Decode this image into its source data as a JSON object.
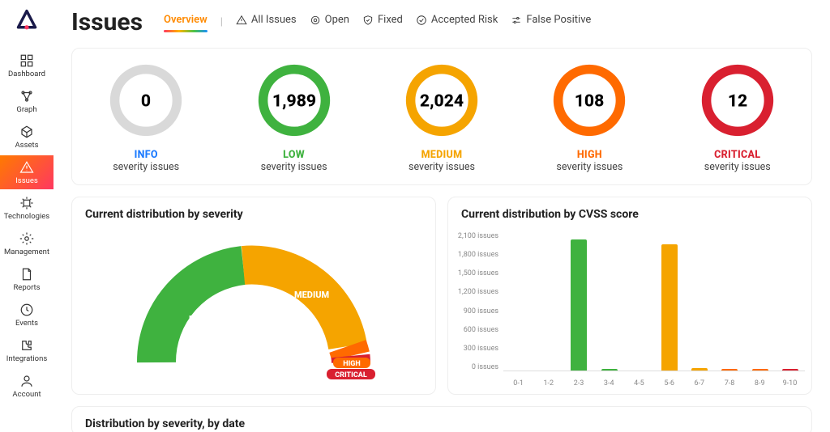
{
  "page": {
    "title": "Issues"
  },
  "sidebar": {
    "items": [
      {
        "label": "Dashboard"
      },
      {
        "label": "Graph"
      },
      {
        "label": "Assets"
      },
      {
        "label": "Issues"
      },
      {
        "label": "Technologies"
      },
      {
        "label": "Management"
      },
      {
        "label": "Reports"
      },
      {
        "label": "Events"
      },
      {
        "label": "Integrations"
      },
      {
        "label": "Account"
      }
    ]
  },
  "tabs": {
    "overview": "Overview",
    "all": "All Issues",
    "open": "Open",
    "fixed": "Fixed",
    "accepted": "Accepted Risk",
    "false_positive": "False Positive"
  },
  "severity": {
    "sub": "severity issues",
    "info": {
      "label": "INFO",
      "count": "0",
      "color": "#1e7cff",
      "ring": "#d9d9d9"
    },
    "low": {
      "label": "LOW",
      "count": "1,989",
      "color": "#3fb23f",
      "ring": "#3fb23f"
    },
    "medium": {
      "label": "MEDIUM",
      "count": "2,024",
      "color": "#f5a400",
      "ring": "#f5a400"
    },
    "high": {
      "label": "HIGH",
      "count": "108",
      "color": "#ff6a00",
      "ring": "#ff6a00"
    },
    "critical": {
      "label": "CRITICAL",
      "count": "12",
      "color": "#d92030",
      "ring": "#d92030"
    }
  },
  "panels": {
    "dist_severity": "Current distribution by severity",
    "dist_cvss": "Current distribution by CVSS score",
    "dist_by_date": "Distribution by severity, by date"
  },
  "gauge": {
    "low": "LOW",
    "medium": "MEDIUM",
    "high": "HIGH",
    "critical": "CRITICAL"
  },
  "chart_data": {
    "type": "bar",
    "title": "Current distribution by CVSS score",
    "xlabel": "",
    "ylabel": "issues",
    "ylim": [
      0,
      2100
    ],
    "y_ticks": [
      "2,100 issues",
      "1,800 issues",
      "1,500 issues",
      "1,200 issues",
      "900 issues",
      "600 issues",
      "300 issues",
      "0 issues"
    ],
    "categories": [
      "0-1",
      "1-2",
      "2-3",
      "3-4",
      "4-5",
      "5-6",
      "6-7",
      "7-8",
      "8-9",
      "9-10"
    ],
    "series": [
      {
        "name": "issues",
        "values": [
          0,
          0,
          1989,
          20,
          0,
          1920,
          35,
          30,
          30,
          20
        ],
        "colors": [
          "#d9d9d9",
          "#d9d9d9",
          "#3fb23f",
          "#3fb23f",
          "#f5a400",
          "#f5a400",
          "#f5a400",
          "#ff6a00",
          "#ff6a00",
          "#d92030"
        ]
      }
    ]
  }
}
